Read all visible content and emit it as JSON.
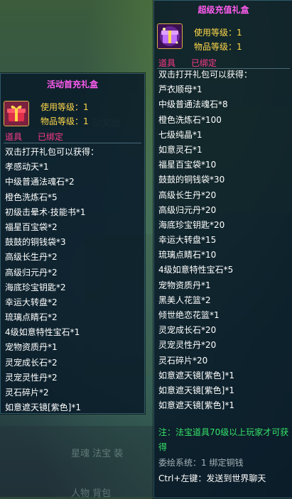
{
  "left_tooltip": {
    "title": "活动首充礼盒",
    "use_level": "使用等级：1",
    "item_level": "物品等级：1",
    "tag_item": "道具",
    "tag_bound": "已绑定",
    "lines": [
      "双击打开礼包可以获得：",
      "孝感动天*1",
      "中级普通法魂石*2",
      "橙色洗炼石*5",
      "初级击晕术·技能书*1",
      "福星百宝袋*2",
      "鼓鼓的铜钱袋*3",
      "高级长生丹*2",
      "高级归元丹*2",
      "海底珍宝钥匙*2",
      "幸运大转盘*2",
      "琉璃点睛石*2",
      "4级如意特性宝石*1",
      "宠物资质丹*1",
      "灵宠成长石*2",
      "灵宠灵性丹*2",
      "灵石碎片*2",
      "如意遮天镜[紫色]*1"
    ]
  },
  "right_tooltip": {
    "title": "超级充值礼盒",
    "use_level": "使用等级：1",
    "item_level": "物品等级：1",
    "tag_item": "道具",
    "tag_bound": "已绑定",
    "lines": [
      "双击打开礼包可以获得：",
      "芦衣顺母*1",
      "中级普通法魂石*8",
      "橙色洗炼石*100",
      "七级纯晶*1",
      "如意灵石*1",
      "福星百宝袋*10",
      "鼓鼓的铜钱袋*30",
      "高级长生丹*20",
      "高级归元丹*20",
      "海底珍宝钥匙*20",
      "幸运大转盘*15",
      "琉璃点睛石*10",
      "4级如意特性宝石*5",
      "宠物资质丹*1",
      "黑美人花篮*2",
      "倾世绝恋花篮*1",
      "灵宠成长石*20",
      "灵宠灵性丹*20",
      "灵石碎片*20",
      "如意遮天镜[紫色]*1",
      "如意遮天镜[紫色]*1",
      "如意遮天镜[紫色]*1"
    ],
    "note": "注：法宝道具70级以上玩家才可获得",
    "system": "委绘系统：1 绑定铜钱",
    "shortcut": "Ctrl+左键：发送到世界聊天"
  },
  "colors": {
    "title": "#ff5cf0",
    "level": "#ffd84a",
    "tag": "#ff3b8a",
    "note": "#36e36a"
  },
  "icons": {
    "left": "red-gift-box-icon",
    "right": "purple-gift-box-icon"
  }
}
